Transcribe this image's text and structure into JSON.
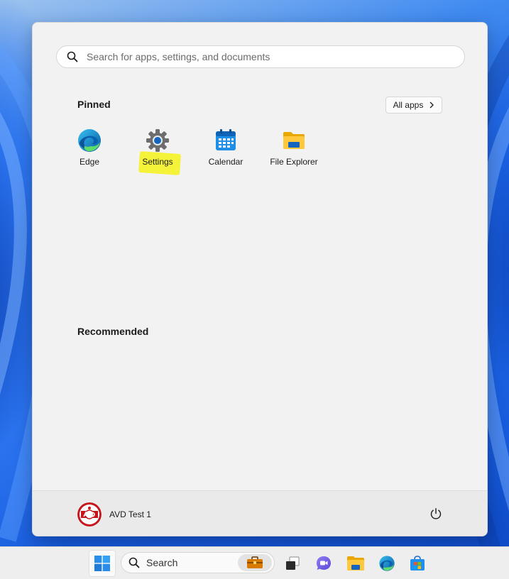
{
  "start_menu": {
    "search": {
      "placeholder": "Search for apps, settings, and documents"
    },
    "pinned": {
      "title": "Pinned",
      "all_apps_label": "All apps",
      "apps": [
        {
          "label": "Edge",
          "icon": "edge-icon"
        },
        {
          "label": "Settings",
          "icon": "gear-icon"
        },
        {
          "label": "Calendar",
          "icon": "calendar-icon"
        },
        {
          "label": "File Explorer",
          "icon": "folder-icon"
        }
      ]
    },
    "recommended": {
      "title": "Recommended"
    },
    "user": {
      "name": "AVD Test 1",
      "avatar": "avatar-logo"
    }
  },
  "taskbar": {
    "search_label": "Search",
    "items": [
      "windows-start-icon",
      "search-icon",
      "briefcase-icon",
      "task-view-icon",
      "chat-icon",
      "file-explorer-icon",
      "edge-icon",
      "store-icon"
    ]
  },
  "colors": {
    "accent": "#0067c0",
    "highlight": "#f5f23a",
    "menu_background": "#f2f2f2"
  }
}
